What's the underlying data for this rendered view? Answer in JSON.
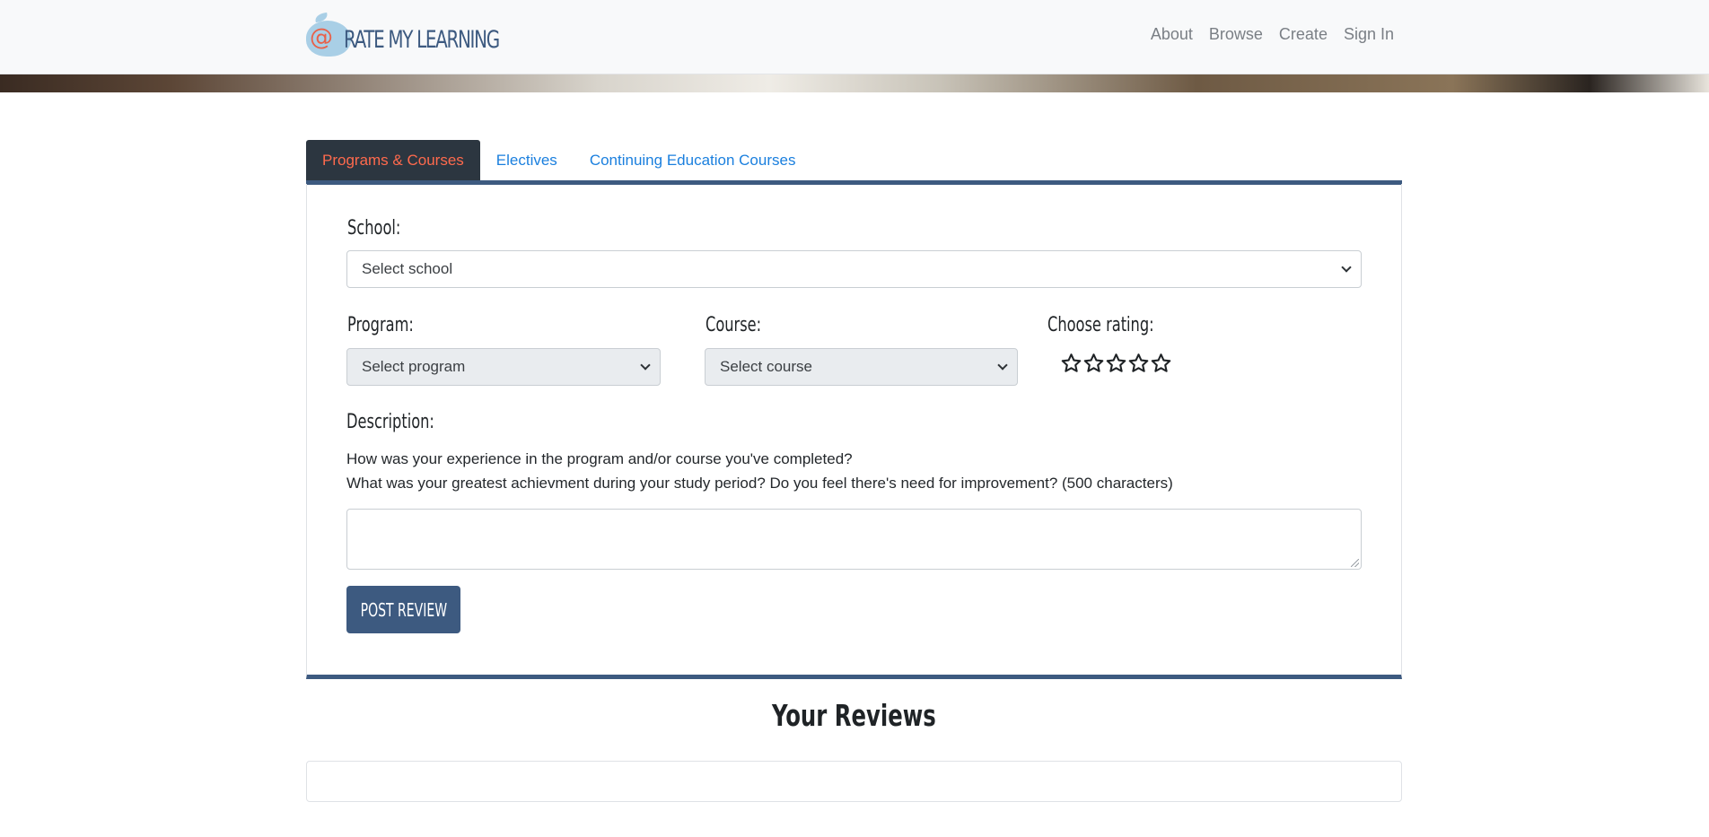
{
  "navbar": {
    "logo_text": "RATE MY LEARNING",
    "logo_mark": "@",
    "links": [
      "About",
      "Browse",
      "Create",
      "Sign In"
    ]
  },
  "tabs": [
    "Programs & Courses",
    "Electives",
    "Continuing Education Courses"
  ],
  "form": {
    "school_label": "School:",
    "school_select": "Select school",
    "program_label": "Program:",
    "program_select": "Select program",
    "course_label": "Course:",
    "course_select": "Select course",
    "rating_label": "Choose rating:",
    "rating_stars": 5,
    "rating_value": 0,
    "description_label": "Description:",
    "description_help_1": "How was your experience in the program and/or course you've completed?",
    "description_help_2": "What was your greatest achievment during your study period? Do you feel there's need for improvement? (500 characters)",
    "description_value": "",
    "post_button": "POST REVIEW"
  },
  "reviews": {
    "title": "Your Reviews"
  },
  "colors": {
    "accent": "#3d5a80",
    "tab_active_bg": "#2c3640",
    "tab_active_text": "#ff6a4d",
    "link": "#1a7fde"
  }
}
